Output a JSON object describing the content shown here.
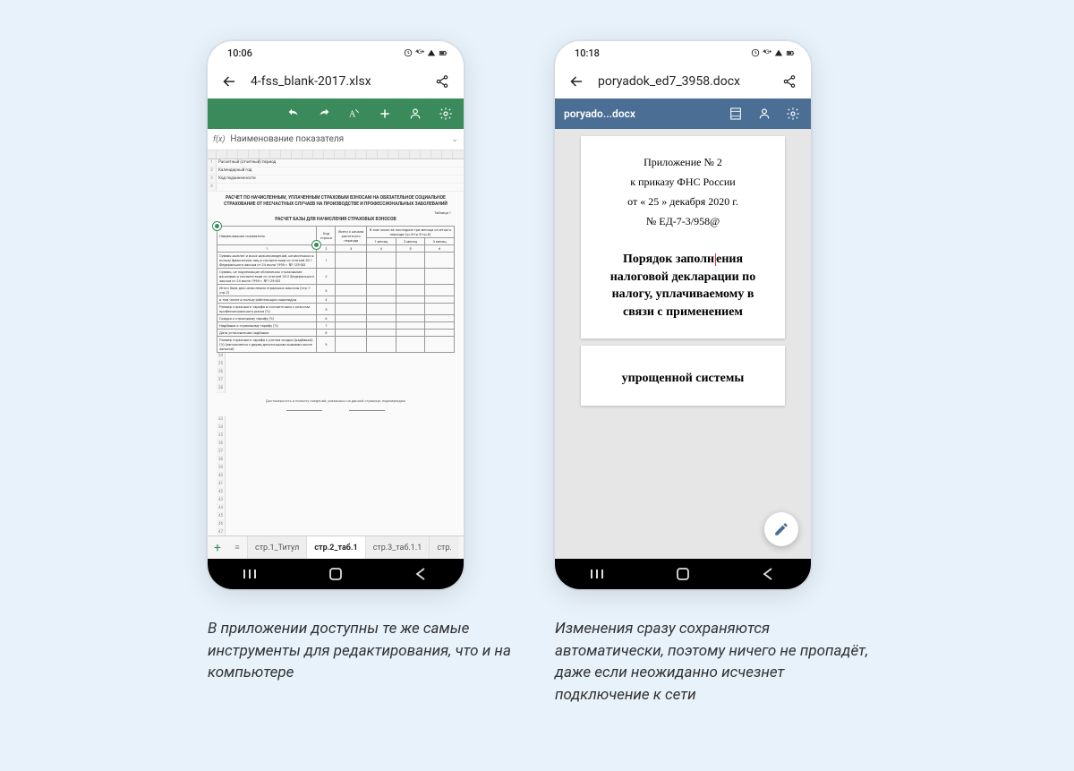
{
  "phone1": {
    "status_time": "10:06",
    "file_name": "4-fss_blank-2017.xlsx",
    "fx_label": "f(x)",
    "fx_value": "Наименование показателя",
    "doc_heading": "РАСЧЕТ ПО НАЧИСЛЕННЫМ, УПЛАЧЕННЫМ СТРАХОВЫМ ВЗНОСАМ НА ОБЯЗАТЕЛЬНОЕ СОЦИАЛЬНОЕ СТРАХОВАНИЕ ОТ НЕСЧАСТНЫХ СЛУЧАЕВ НА ПРОИЗВОДСТВЕ И ПРОФЕССИОНАЛЬНЫХ ЗАБОЛЕВАНИЙ",
    "table_note": "Таблица 1",
    "doc_subheading": "РАСЧЕТ БАЗЫ ДЛЯ НАЧИСЛЕНИЯ СТРАХОВЫХ ВЗНОСОВ",
    "row_label1": "Расчетный (отчетный) период",
    "row_label2": "Календарный год",
    "row_label3": "Код подчиненности",
    "col_headers": {
      "name": "Наименование показателя",
      "code": "Код строки",
      "total": "Всего с начала расчетного периода",
      "period_group": "В том числе за последние три месяца отчетного периода (гр.4+гр.5+гр.6)",
      "m1": "1 месяц",
      "m2": "2 месяц",
      "m3": "3 месяц",
      "n1": "1",
      "n2": "2",
      "n3": "3",
      "n4": "4",
      "n5": "5",
      "n6": "6"
    },
    "rows": [
      "Суммы выплат и иных вознаграждений, начисленных в пользу физических лиц в соответствии со статьей 20.1 Федерального закона от 24 июля 1998 г. № 125-ФЗ",
      "Суммы, не подлежащие обложению страховыми взносами в соответствии со статьей 20.2 Федерального закона от 24 июля 1998 г. № 125-ФЗ",
      "Итого база для начисления страховых взносов (стр.1-стр.2)",
      "в том числе в пользу работающих инвалидов",
      "Размер страхового тарифа в соответствии с классом профессионального риска (%)",
      "Скидка к страховому тарифу (%)",
      "Надбавка к страховому тарифу (%)",
      "Дата установления надбавки",
      "Размер страхового тарифа с учетом скидки (надбавки) (%) (заполняется с двумя десятичными знаками после запятой)"
    ],
    "confirm_text": "Достоверность и полноту сведений, указанных на данной странице, подтверждаю",
    "tabs": {
      "t1": "стр.1_Титул",
      "t2": "стр.2_таб.1",
      "t3": "стр.3_таб.1.1",
      "t4": "стр."
    }
  },
  "phone2": {
    "status_time": "10:18",
    "file_name": "poryadok_ed7_3958.docx",
    "doc_tab_name": "poryado...docx",
    "hdr1": "Приложение № 2",
    "hdr2": "к приказу ФНС России",
    "hdr3": "от  « 25 »  декабря 2020 г.",
    "hdr4": "№ ЕД-7-3/958@",
    "title_a": "Порядок заполн",
    "title_b": "ения налоговой декларации по налогу, уплачиваемому в связи с применением",
    "page2_text": "упрощенной системы"
  },
  "captions": {
    "left": "В приложении доступны те же самые инструменты для редактирования, что и на компьютере",
    "right": "Изменения сразу сохраняются автоматически, поэтому ничего не пропадёт, даже если неожиданно исчезнет подключение к сети"
  }
}
